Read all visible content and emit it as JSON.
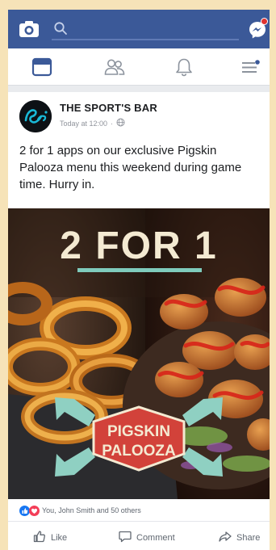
{
  "post": {
    "page_name": "THE SPORT'S BAR",
    "timestamp": "Today at 12:00",
    "separator": "·",
    "text": "2 for 1 apps on our exclusive Pigskin Palooza menu this weekend during game time. Hurry in.",
    "image": {
      "headline": "2 FOR 1",
      "badge_line1": "PIGSKIN",
      "badge_line2": "PALOOZA"
    },
    "reactions_text": "You, John Smith and 50 others"
  },
  "actions": {
    "like": "Like",
    "comment": "Comment",
    "share": "Share"
  },
  "colors": {
    "brand": "#3b5998",
    "notification": "#e0322f",
    "like_blue": "#1877f2",
    "love_red": "#f33e58"
  },
  "icons": {
    "top_bar": [
      "camera-icon",
      "search-icon",
      "messenger-icon"
    ],
    "nav": [
      "news-feed-icon",
      "friends-icon",
      "notifications-icon",
      "menu-icon"
    ]
  }
}
